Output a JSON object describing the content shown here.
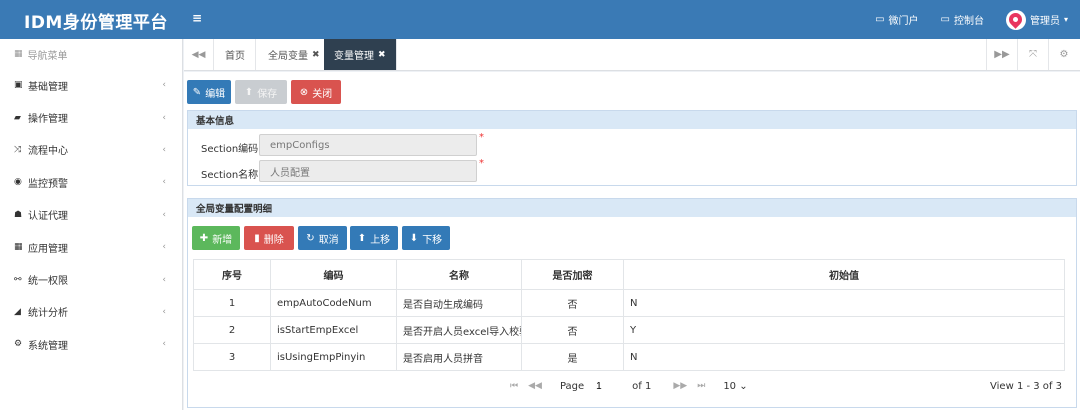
{
  "app": {
    "title": "IDM身份管理平台",
    "menu_toggle": "≡"
  },
  "header": {
    "portal": "微门户",
    "console": "控制台",
    "user": "管理员"
  },
  "sidebar": {
    "title": "导航菜单",
    "items": [
      {
        "label": "基础管理",
        "icon": "id-card-icon",
        "glyph": "▣"
      },
      {
        "label": "操作管理",
        "icon": "book-icon",
        "glyph": "▰"
      },
      {
        "label": "流程中心",
        "icon": "shuffle-icon",
        "glyph": "⤨"
      },
      {
        "label": "监控预警",
        "icon": "eye-icon",
        "glyph": "◉"
      },
      {
        "label": "认证代理",
        "icon": "users-icon",
        "glyph": "☗"
      },
      {
        "label": "应用管理",
        "icon": "list-icon",
        "glyph": "▦"
      },
      {
        "label": "统一权限",
        "icon": "sitemap-icon",
        "glyph": "⚯"
      },
      {
        "label": "统计分析",
        "icon": "area-chart-icon",
        "glyph": "◢"
      },
      {
        "label": "系统管理",
        "icon": "cogs-icon",
        "glyph": "⚙"
      }
    ]
  },
  "tabs": {
    "items": [
      {
        "label": "首页",
        "closable": false
      },
      {
        "label": "全局变量",
        "closable": true
      },
      {
        "label": "变量管理",
        "closable": true,
        "active": true
      }
    ]
  },
  "toolbar": {
    "edit": "编辑",
    "save": "保存",
    "close": "关闭"
  },
  "basic": {
    "title": "基本信息",
    "code_label": "Section编码",
    "code_value": "empConfigs",
    "name_label": "Section名称",
    "name_value": "人员配置"
  },
  "detail": {
    "title": "全局变量配置明细",
    "add": "新增",
    "delete": "删除",
    "cancel": "取消",
    "up": "上移",
    "down": "下移",
    "columns": [
      "序号",
      "编码",
      "名称",
      "是否加密",
      "初始值"
    ],
    "rows": [
      [
        "1",
        "empAutoCodeNum",
        "是否自动生成编码",
        "否",
        "N"
      ],
      [
        "2",
        "isStartEmpExcel",
        "是否开启人员excel导入校验",
        "否",
        "Y"
      ],
      [
        "3",
        "isUsingEmpPinyin",
        "是否启用人员拼音",
        "是",
        "N"
      ]
    ]
  },
  "pager": {
    "page_label": "Page",
    "page_value": "1",
    "of_label": "of 1",
    "page_size": "10",
    "view": "View 1 - 3 of 3"
  },
  "colors": {
    "topbar": "#3a7ab5",
    "active_tab": "#2f4050",
    "blue": "#337ab7",
    "red": "#d9534f",
    "green": "#5cb85c"
  }
}
